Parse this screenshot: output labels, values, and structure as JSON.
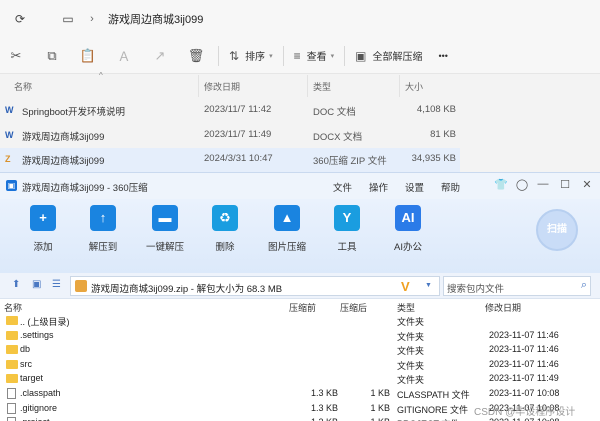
{
  "explorer": {
    "path": "游戏周边商城3ij099",
    "toolbar": {
      "sort_label": "排序",
      "view_label": "查看",
      "extract_all_label": "全部解压缩",
      "more_label": "•••"
    },
    "columns": {
      "name": "名称",
      "date": "修改日期",
      "type": "类型",
      "size": "大小"
    },
    "files": [
      {
        "name": "Springboot开发环境说明",
        "date": "2023/11/7 11:42",
        "type": "DOC 文档",
        "size": "4,108 KB",
        "icon": "doc-icon",
        "selected": false
      },
      {
        "name": "游戏周边商城3ij099",
        "date": "2023/11/7 11:49",
        "type": "DOCX 文档",
        "size": "81 KB",
        "icon": "docx-icon",
        "selected": false
      },
      {
        "name": "游戏周边商城3ij099",
        "date": "2024/3/31 10:47",
        "type": "360压缩 ZIP 文件",
        "size": "34,935 KB",
        "icon": "zip-icon",
        "selected": true
      }
    ]
  },
  "zip_window": {
    "title": "游戏周边商城3ij099 - 360压缩",
    "menu": [
      "文件",
      "操作",
      "设置",
      "帮助"
    ],
    "tools": [
      {
        "label": "添加",
        "icon": "add-icon",
        "color": "#1a84e0"
      },
      {
        "label": "解压到",
        "icon": "extract-to-icon",
        "color": "#1a84e0"
      },
      {
        "label": "一键解压",
        "icon": "one-click-extract-icon",
        "color": "#1a84e0"
      },
      {
        "label": "删除",
        "icon": "recycle-icon",
        "color": "#1a9de0"
      },
      {
        "label": "图片压缩",
        "icon": "image-compress-icon",
        "color": "#1a84e0"
      },
      {
        "label": "工具",
        "icon": "tools-icon",
        "color": "#1a9de0"
      },
      {
        "label": "AI办公",
        "icon": "ai-icon",
        "color": "#2b7be8"
      }
    ],
    "scan_label": "扫描",
    "address": "游戏周边商城3ij099.zip - 解包大小为 68.3 MB",
    "search_placeholder": "搜索包内文件",
    "columns": {
      "name": "名称",
      "compressed": "压缩前",
      "packed": "压缩后",
      "type": "类型",
      "date": "修改日期"
    },
    "rows": [
      {
        "name": ".. (上级目录)",
        "compressed": "",
        "packed": "",
        "type": "文件夹",
        "date": "",
        "kind": "folder"
      },
      {
        "name": ".settings",
        "compressed": "",
        "packed": "",
        "type": "文件夹",
        "date": "2023-11-07 11:46",
        "kind": "folder"
      },
      {
        "name": "db",
        "compressed": "",
        "packed": "",
        "type": "文件夹",
        "date": "2023-11-07 11:46",
        "kind": "folder"
      },
      {
        "name": "src",
        "compressed": "",
        "packed": "",
        "type": "文件夹",
        "date": "2023-11-07 11:46",
        "kind": "folder"
      },
      {
        "name": "target",
        "compressed": "",
        "packed": "",
        "type": "文件夹",
        "date": "2023-11-07 11:49",
        "kind": "folder"
      },
      {
        "name": ".classpath",
        "compressed": "1.3 KB",
        "packed": "1 KB",
        "type": "CLASSPATH 文件",
        "date": "2023-11-07 10:08",
        "kind": "file"
      },
      {
        "name": ".gitignore",
        "compressed": "1.3 KB",
        "packed": "1 KB",
        "type": "GITIGNORE 文件",
        "date": "2023-11-07 10:08",
        "kind": "file"
      },
      {
        "name": ".project",
        "compressed": "1.3 KB",
        "packed": "1 KB",
        "type": "PROJECT 文件",
        "date": "2023-11-07 10:08",
        "kind": "file"
      }
    ]
  },
  "watermark": "CSDN @毕设程序设计"
}
